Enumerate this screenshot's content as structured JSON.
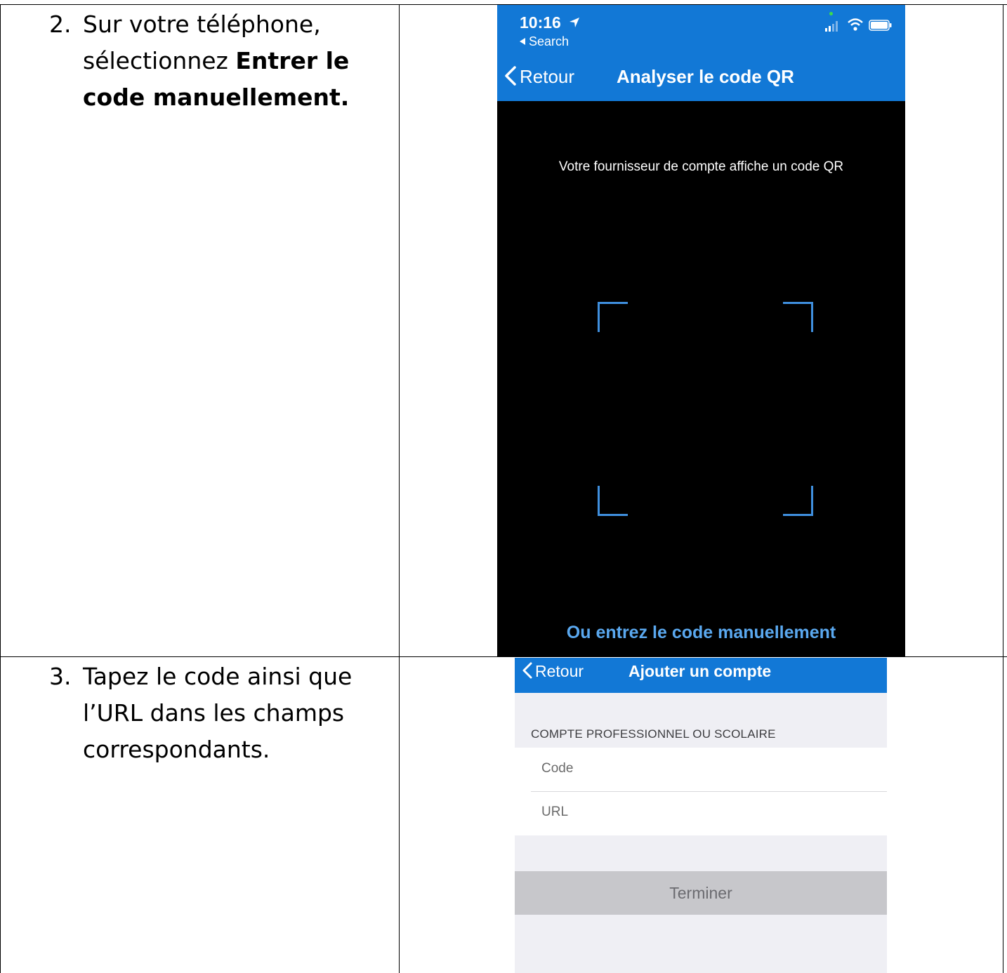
{
  "steps": [
    {
      "number": "2.",
      "text_before": "Sur votre téléphone, sélectionnez ",
      "text_bold": "Entrer le code manuellement."
    },
    {
      "number": "3.",
      "text": "Tapez le code ainsi que l’URL dans les champs correspondants."
    }
  ],
  "screen1": {
    "status_time": "10:16",
    "status_back_app": "Search",
    "back_label": "Retour",
    "title": "Analyser le code QR",
    "hint": "Votre fournisseur de compte affiche un code QR",
    "manual_link": "Ou entrez le code manuellement"
  },
  "screen2": {
    "back_label": "Retour",
    "title": "Ajouter un compte",
    "section_label": "COMPTE PROFESSIONNEL OU SCOLAIRE",
    "code_placeholder": "Code",
    "url_placeholder": "URL",
    "done_label": "Terminer"
  },
  "colors": {
    "nav_blue": "#1278d6",
    "scan_corner": "#3f8fde",
    "link_blue": "#5aa8ef"
  }
}
